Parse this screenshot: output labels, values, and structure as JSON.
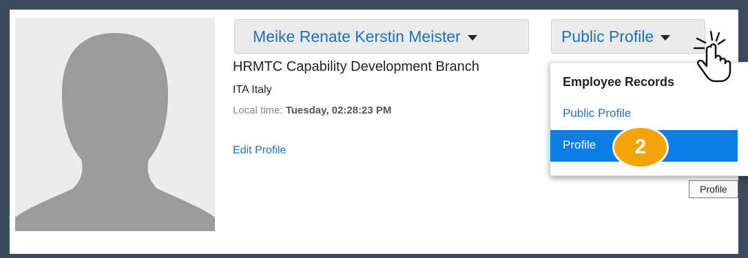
{
  "profile": {
    "name_button": "Meike Renate Kerstin Meister",
    "view_button": "Public Profile",
    "department": "HRMTC Capability Development Branch",
    "country": "ITA Italy",
    "local_time_label": "Local time:",
    "local_time_value": "Tuesday, 02:28:23 PM",
    "edit_link": "Edit Profile"
  },
  "dropdown": {
    "header": "Employee Records",
    "items": [
      {
        "label": "Public Profile"
      },
      {
        "label": "Profile"
      }
    ]
  },
  "step_badge": "2",
  "tooltip": "Profile",
  "colors": {
    "frame": "#3b4a5c",
    "link": "#1a73b8",
    "highlight": "#0a7de6",
    "badge": "#f5a30b"
  },
  "icons": {
    "avatar": "person-silhouette",
    "pointer": "hand-pointer-click"
  }
}
